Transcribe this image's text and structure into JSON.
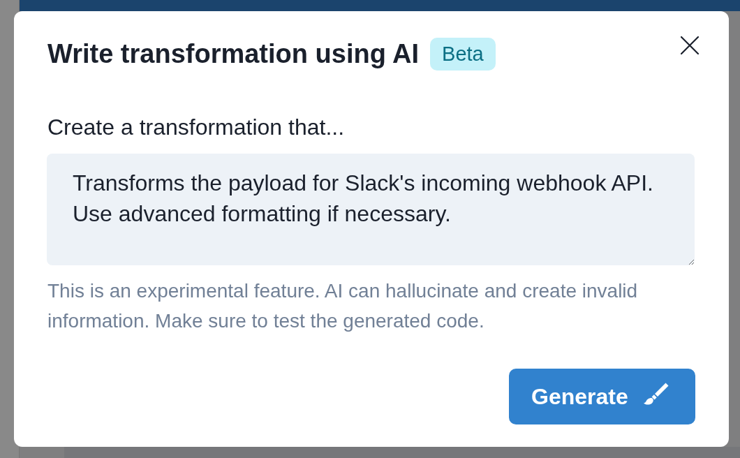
{
  "dialog": {
    "title": "Write transformation using AI",
    "badge": "Beta",
    "prompt_label": "Create a transformation that...",
    "prompt_field": {
      "value": "Transforms the payload for Slack's incoming webhook API. Use advanced formatting if necessary."
    },
    "helper_text": "This is an experimental feature. AI can hallucinate and create invalid information. Make sure to test the generated code.",
    "primary_button": {
      "label": "Generate"
    }
  }
}
